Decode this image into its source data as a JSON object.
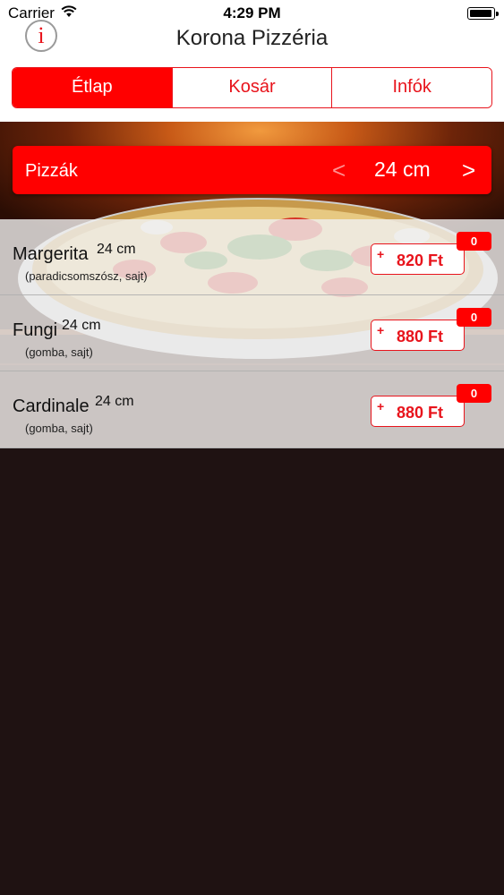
{
  "status_bar": {
    "carrier": "Carrier",
    "time": "4:29 PM"
  },
  "app": {
    "title": "Korona Pizzéria",
    "info_icon": "i"
  },
  "tabs": [
    {
      "label": "Étlap",
      "active": true
    },
    {
      "label": "Kosár",
      "active": false
    },
    {
      "label": "Infók",
      "active": false
    }
  ],
  "category": {
    "name": "Pizzák",
    "size": "24 cm",
    "prev": "<",
    "next": ">"
  },
  "items": [
    {
      "name": "Margerita",
      "size": "24 cm",
      "description": "(paradicsomszósz, sajt)",
      "plus": "+",
      "price": "820 Ft",
      "count": "0"
    },
    {
      "name": "Fungi",
      "size": "24 cm",
      "description": "(gomba, sajt)",
      "plus": "+",
      "price": "880 Ft",
      "count": "0"
    },
    {
      "name": "Cardinale",
      "size": "24 cm",
      "description": "(gomba, sajt)",
      "plus": "+",
      "price": "880 Ft",
      "count": "0"
    }
  ],
  "colors": {
    "accent": "#ff0000",
    "accent_text": "#e8141c",
    "background": "#1f1212"
  }
}
